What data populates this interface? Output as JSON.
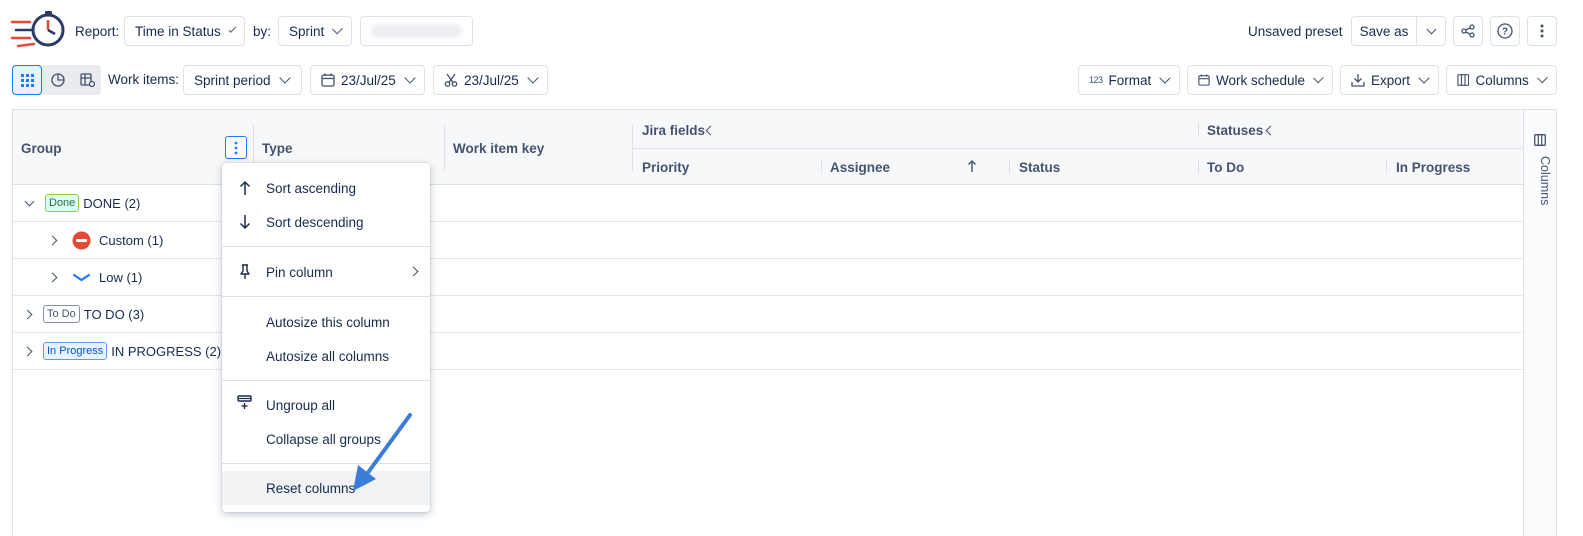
{
  "toolbar": {
    "report_label": "Report:",
    "report_value": "Time in Status",
    "by_label": "by:",
    "by_value": "Sprint",
    "preset_status": "Unsaved preset",
    "save_as": "Save as"
  },
  "toolbar2": {
    "work_items_label": "Work items:",
    "period": "Sprint period",
    "start_date": "23/Jul/25",
    "end_date": "23/Jul/25",
    "format": "Format",
    "format_prefix": "123",
    "work_schedule": "Work schedule",
    "export": "Export",
    "columns": "Columns"
  },
  "table": {
    "col_group": "Group",
    "col_type": "Type",
    "col_key": "Work item key",
    "group_jira": "Jira fields",
    "group_statuses": "Statuses",
    "col_priority": "Priority",
    "col_assignee": "Assignee",
    "col_status": "Status",
    "col_todo": "To Do",
    "col_inprogress": "In Progress",
    "side_panel": "Columns",
    "rows": [
      {
        "tag": "Done",
        "label": "DONE (2)"
      },
      {
        "label": "Custom (1)"
      },
      {
        "label": "Low (1)"
      },
      {
        "tag": "To Do",
        "label": "TO DO (3)"
      },
      {
        "tag": "In Progress",
        "label": "IN PROGRESS (2)"
      }
    ]
  },
  "menu": {
    "sort_asc": "Sort ascending",
    "sort_desc": "Sort descending",
    "pin": "Pin column",
    "autosize_this": "Autosize this column",
    "autosize_all": "Autosize all columns",
    "ungroup": "Ungroup all",
    "collapse": "Collapse all groups",
    "reset": "Reset columns"
  },
  "colors": {
    "accent": "#1d7afc",
    "arrow": "#3b7dd8",
    "done_tag_bg": "#dcfff1",
    "done_tag_border": "#94c748",
    "inprogress_tag_bg": "#e9f2ff",
    "blocker_red": "#e34935"
  }
}
